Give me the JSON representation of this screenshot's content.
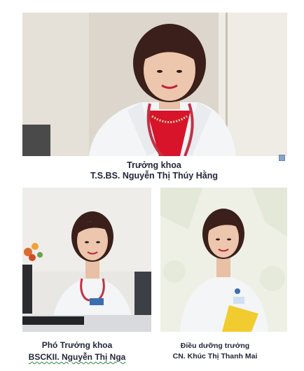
{
  "captions": {
    "head": {
      "title": "Trưởng khoa",
      "name": "T.S.BS. Nguyễn Thị Thúy Hằng"
    },
    "deputy": {
      "title": "Phó Trưởng khoa",
      "name": "BSCKII. Nguyễn Thị Nga"
    },
    "nurse": {
      "title": "Điều dưỡng trưởng",
      "name": "CN. Khúc Thị Thanh Mai"
    }
  },
  "colors": {
    "caption_text": "#23273a",
    "white_coat": "#f4f5f7",
    "hair": "#3a1f1a",
    "skin": "#e8c0a6",
    "stethoscope": "#c23245"
  }
}
